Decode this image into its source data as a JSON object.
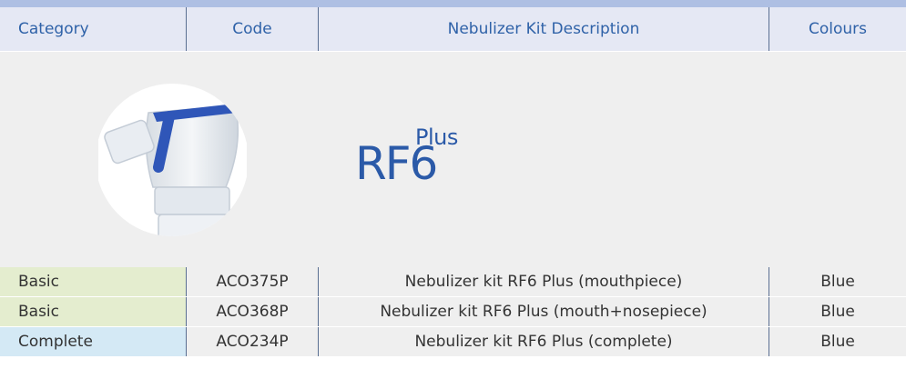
{
  "header": {
    "columns": [
      "Category",
      "Code",
      "Nebulizer Kit Description",
      "Colours"
    ]
  },
  "logo": {
    "plus": "Plus",
    "model": "RF6"
  },
  "colors": {
    "header_text": "#2f62a8",
    "header_bg": "#e5e8f4",
    "basic_bg": "#e4edcf",
    "complete_bg": "#d4e9f5",
    "logo_blue": "#2b5aa8"
  },
  "rows": [
    {
      "category": "Basic",
      "code": "ACO375P",
      "description": "Nebulizer kit RF6 Plus (mouthpiece)",
      "colour": "Blue",
      "category_bg": "#e4edcf"
    },
    {
      "category": "Basic",
      "code": "ACO368P",
      "description": "Nebulizer kit RF6 Plus (mouth+nosepiece)",
      "colour": "Blue",
      "category_bg": "#e4edcf"
    },
    {
      "category": "Complete",
      "code": "ACO234P",
      "description": "Nebulizer kit RF6 Plus (complete)",
      "colour": "Blue",
      "category_bg": "#d4e9f5"
    }
  ]
}
